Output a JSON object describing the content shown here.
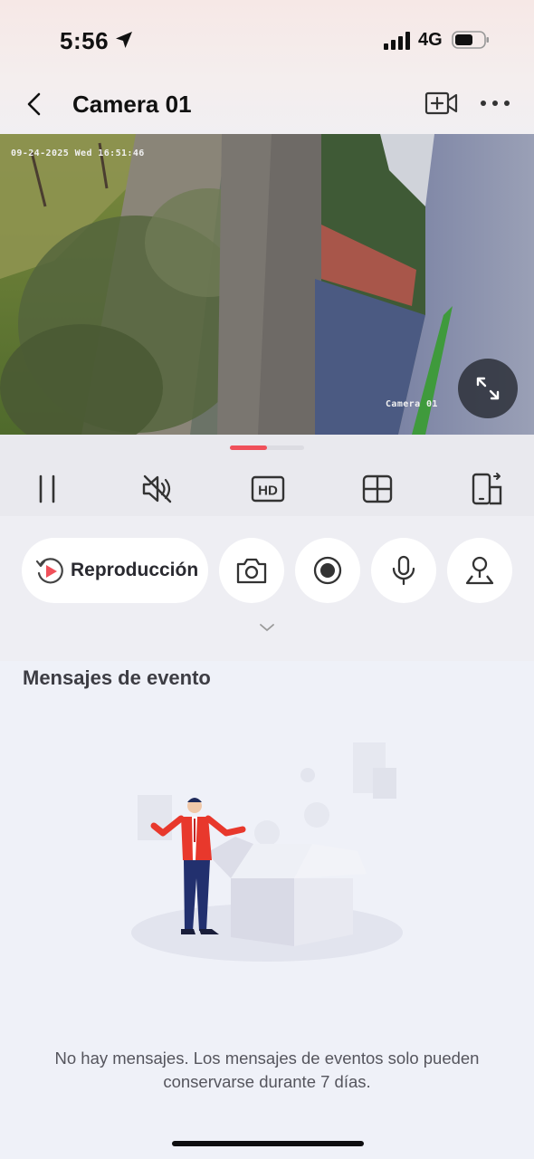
{
  "status_bar": {
    "time": "5:56",
    "network": "4G",
    "icons": [
      "location-arrow-icon",
      "signal-icon",
      "battery-icon"
    ]
  },
  "nav": {
    "title": "Camera 01",
    "icons": [
      "back-icon",
      "add-camera-icon",
      "more-icon"
    ]
  },
  "video": {
    "osd_timestamp": "09-24-2025 Wed 16:51:46",
    "osd_camera_name": "Camera 01",
    "icons": [
      "fullscreen-icon"
    ]
  },
  "controls": {
    "page_indicator": {
      "pages": 2,
      "active": 1
    },
    "icons": [
      "pause-icon",
      "mute-icon",
      "hd-icon",
      "grid-icon",
      "device-switch-icon"
    ],
    "hd_label": "HD"
  },
  "actions": {
    "playback_label": "Reproducción",
    "icons": [
      "playback-icon",
      "camera-icon",
      "record-icon",
      "microphone-icon",
      "ptz-icon",
      "chevron-down-icon"
    ]
  },
  "events": {
    "title": "Mensajes de evento",
    "empty_message": "No hay mensajes. Los mensajes de eventos solo pueden conservarse durante 7 días."
  },
  "colors": {
    "accent": "#f0505a",
    "background": "#eff1f8",
    "dark_button": "#282c34"
  }
}
